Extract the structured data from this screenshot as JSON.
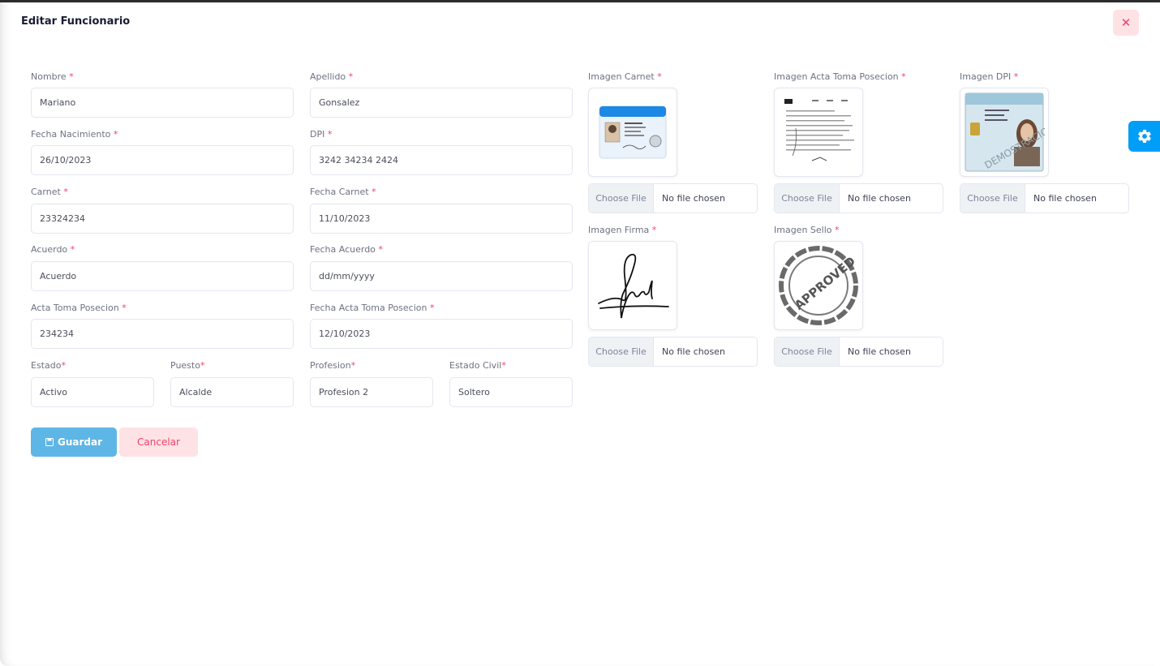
{
  "modal": {
    "title": "Editar Funcionario",
    "close_symbol": "✕"
  },
  "required_mark": "*",
  "fields": {
    "nombre": {
      "label": "Nombre",
      "value": "Mariano"
    },
    "apellido": {
      "label": "Apellido",
      "value": "Gonsalez"
    },
    "fecha_nacimiento": {
      "label": "Fecha Nacimiento",
      "value": "26/10/2023"
    },
    "dpi": {
      "label": "DPI",
      "value": "3242 34234 2424"
    },
    "carnet": {
      "label": "Carnet",
      "value": "23324234"
    },
    "fecha_carnet": {
      "label": "Fecha Carnet",
      "value": "11/10/2023"
    },
    "acuerdo": {
      "label": "Acuerdo",
      "value": "Acuerdo"
    },
    "fecha_acuerdo": {
      "label": "Fecha Acuerdo",
      "value": "dd/mm/yyyy"
    },
    "acta_toma_posecion": {
      "label": "Acta Toma Posecion",
      "value": "234234"
    },
    "fecha_acta_toma_posecion": {
      "label": "Fecha Acta Toma Posecion",
      "value": "12/10/2023"
    },
    "estado": {
      "label": "Estado",
      "value": "Activo"
    },
    "puesto": {
      "label": "Puesto",
      "value": "Alcalde"
    },
    "profesion": {
      "label": "Profesion",
      "value": "Profesion 2"
    },
    "estado_civil": {
      "label": "Estado Civil",
      "value": "Soltero"
    }
  },
  "images": {
    "carnet": {
      "label": "Imagen Carnet"
    },
    "acta": {
      "label": "Imagen Acta Toma Posecion"
    },
    "dpi": {
      "label": "Imagen DPI",
      "watermark": "DEMOSTRACION"
    },
    "firma": {
      "label": "Imagen Firma"
    },
    "sello": {
      "label": "Imagen Sello",
      "stamp_text": "APPROVED"
    }
  },
  "file_input": {
    "button": "Choose File",
    "status": "No file chosen"
  },
  "actions": {
    "save": "Guardar",
    "cancel": "Cancelar"
  },
  "icons": {
    "close": "close-icon",
    "settings": "gear-icon",
    "save": "save-icon"
  },
  "colors": {
    "primary": "#5eb6e6",
    "danger": "#f1416c",
    "settings": "#009ef7"
  }
}
